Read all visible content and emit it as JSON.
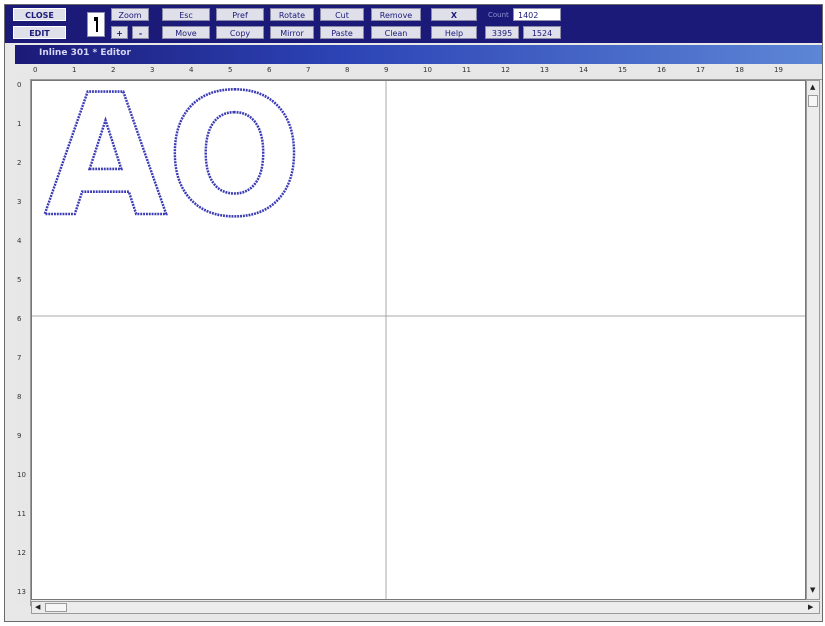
{
  "toolbar": {
    "close": "CLOSE",
    "edit": "EDIT",
    "zoom": "Zoom",
    "zoom_in": "+",
    "zoom_out": "-",
    "esc": "Esc",
    "move": "Move",
    "pref": "Pref",
    "copy": "Copy",
    "rotate": "Rotate",
    "mirror": "Mirror",
    "cut": "Cut",
    "paste": "Paste",
    "remove": "Remove",
    "clean": "Clean",
    "x": "X",
    "help": "Help",
    "count_label": "Count",
    "count_value": "1402",
    "coord_x": "3395",
    "coord_y": "1524"
  },
  "editor": {
    "title": "Inline 301 * Editor",
    "design_text": "AO",
    "design_stroke_color": "#3b3bb5"
  },
  "rulers": {
    "horizontal": [
      "0",
      "1",
      "2",
      "3",
      "4",
      "5",
      "6",
      "7",
      "8",
      "9",
      "10",
      "11",
      "12",
      "13",
      "14",
      "15",
      "16",
      "17",
      "18",
      "19"
    ],
    "vertical": [
      "0",
      "1",
      "2",
      "3",
      "4",
      "5",
      "6",
      "7",
      "8",
      "9",
      "10",
      "11",
      "12",
      "13"
    ]
  },
  "colors": {
    "toolbar_bg": "#1b1a78",
    "button_bg": "#dfe0ea"
  }
}
